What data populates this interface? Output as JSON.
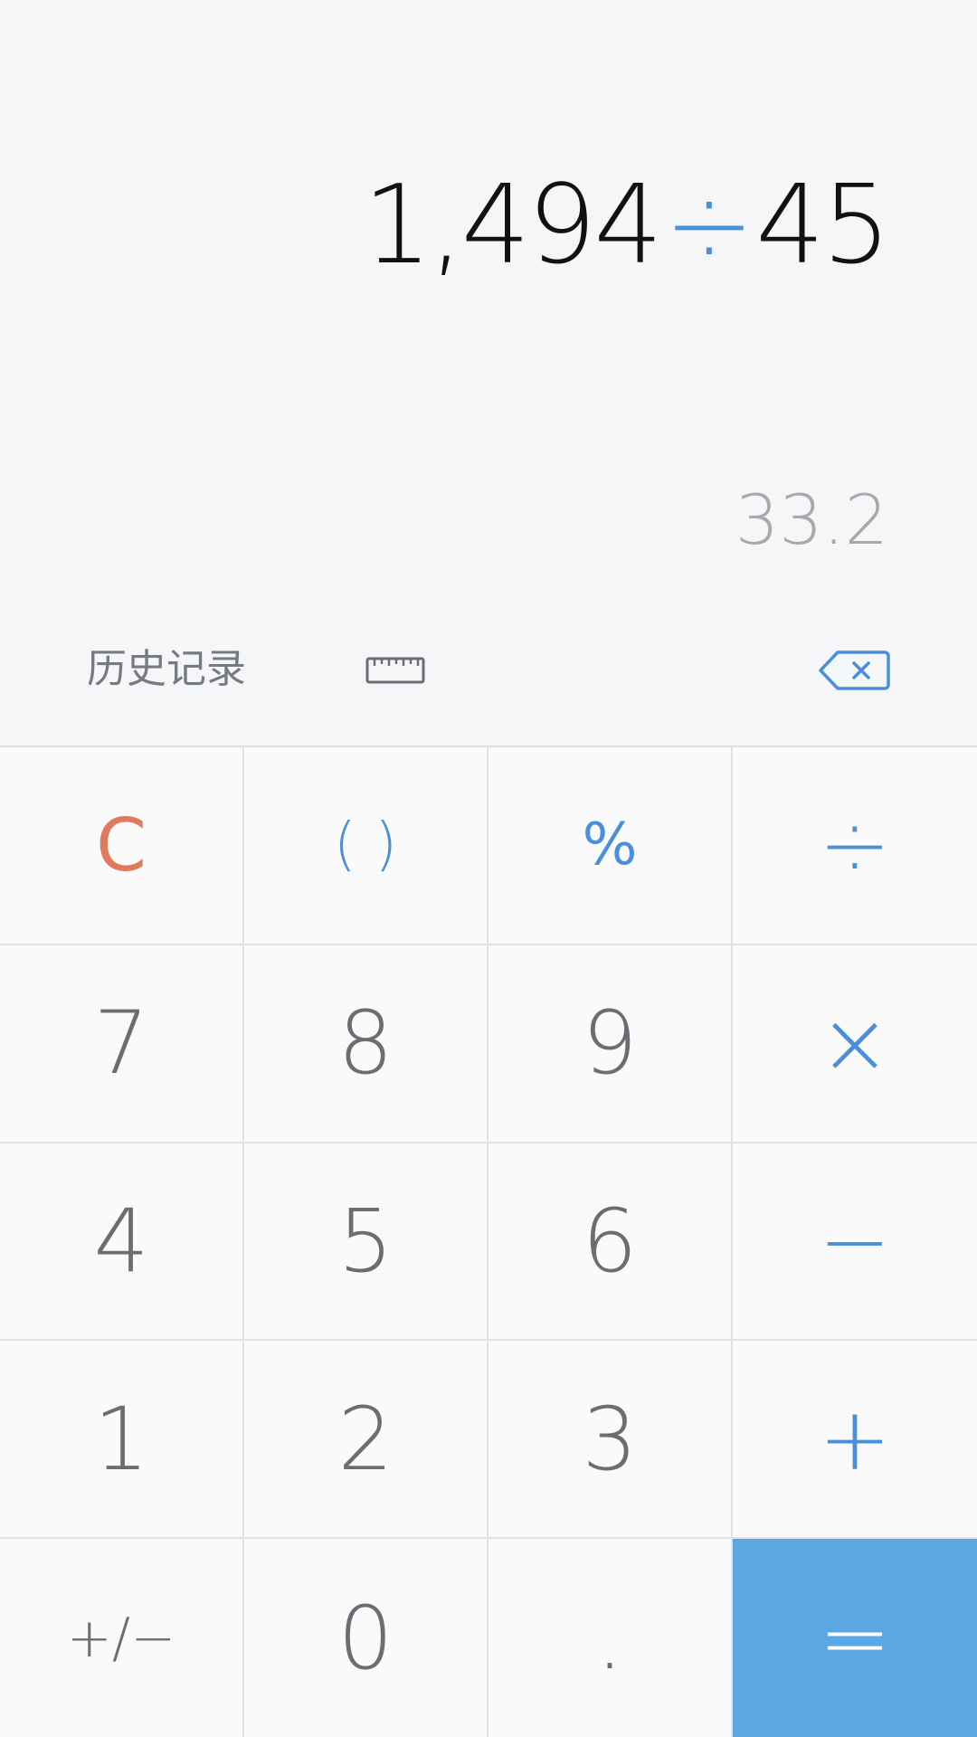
{
  "display": {
    "expression_left": "1,494",
    "expression_op": "÷",
    "expression_right": "45",
    "result": "33.2"
  },
  "toolbar": {
    "history_label": "历史记录",
    "icons": [
      "ruler-icon",
      "backspace-icon"
    ]
  },
  "keys": [
    {
      "label": "C",
      "name": "clear-button"
    },
    {
      "label": "( )",
      "name": "parentheses-button"
    },
    {
      "label": "%",
      "name": "percent-button"
    },
    {
      "label": "÷",
      "name": "divide-button"
    },
    {
      "label": "7",
      "name": "digit-7-button"
    },
    {
      "label": "8",
      "name": "digit-8-button"
    },
    {
      "label": "9",
      "name": "digit-9-button"
    },
    {
      "label": "×",
      "name": "multiply-button"
    },
    {
      "label": "4",
      "name": "digit-4-button"
    },
    {
      "label": "5",
      "name": "digit-5-button"
    },
    {
      "label": "6",
      "name": "digit-6-button"
    },
    {
      "label": "−",
      "name": "subtract-button"
    },
    {
      "label": "1",
      "name": "digit-1-button"
    },
    {
      "label": "2",
      "name": "digit-2-button"
    },
    {
      "label": "3",
      "name": "digit-3-button"
    },
    {
      "label": "+",
      "name": "add-button"
    },
    {
      "label": "+/−",
      "name": "negate-button"
    },
    {
      "label": "0",
      "name": "digit-0-button"
    },
    {
      "label": ".",
      "name": "decimal-button"
    },
    {
      "label": "=",
      "name": "equals-button"
    }
  ],
  "colors": {
    "accent": "#4a90d9",
    "clear": "#e07a5f",
    "equals_bg": "#5ba7e4",
    "digit": "#6b6d72"
  }
}
